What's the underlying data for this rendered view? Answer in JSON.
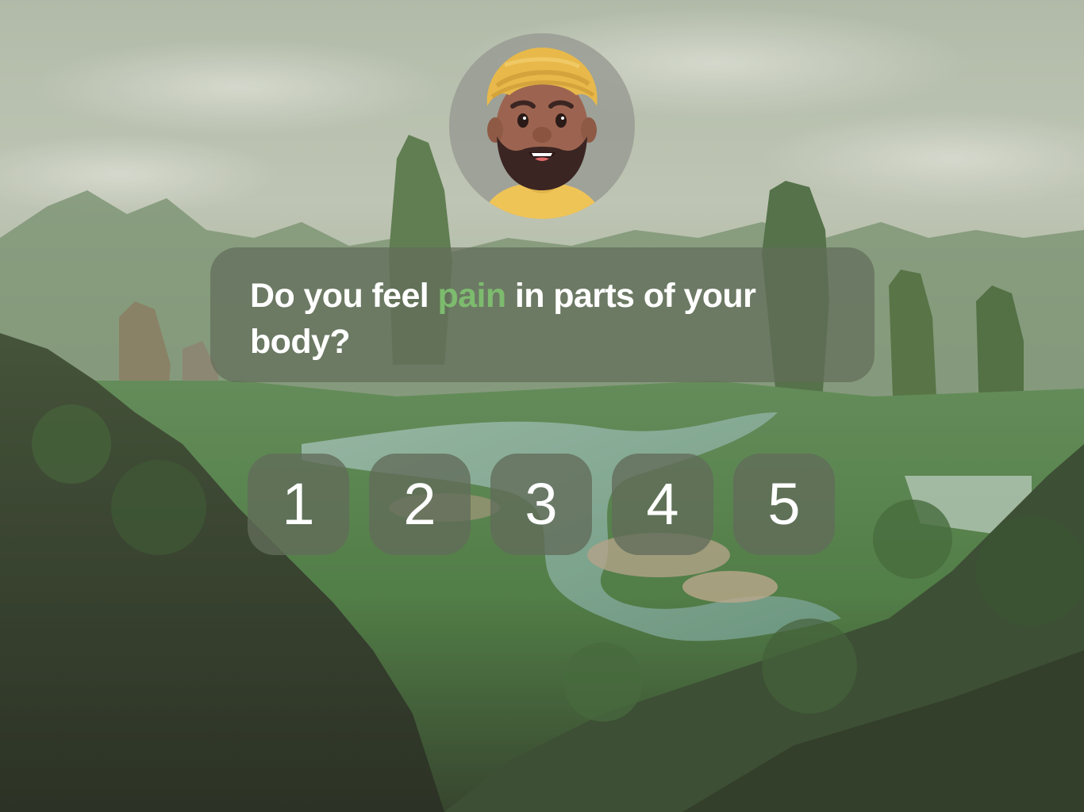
{
  "question": {
    "prefix": "Do you feel ",
    "highlight": "pain",
    "suffix": " in parts of your body?",
    "highlight_color": "#7dbb6e"
  },
  "avatar": {
    "icon": "avatar-turban-man-icon"
  },
  "rating": {
    "options": [
      "1",
      "2",
      "3",
      "4",
      "5"
    ]
  },
  "background": {
    "icon": "mountain-valley-landscape"
  }
}
